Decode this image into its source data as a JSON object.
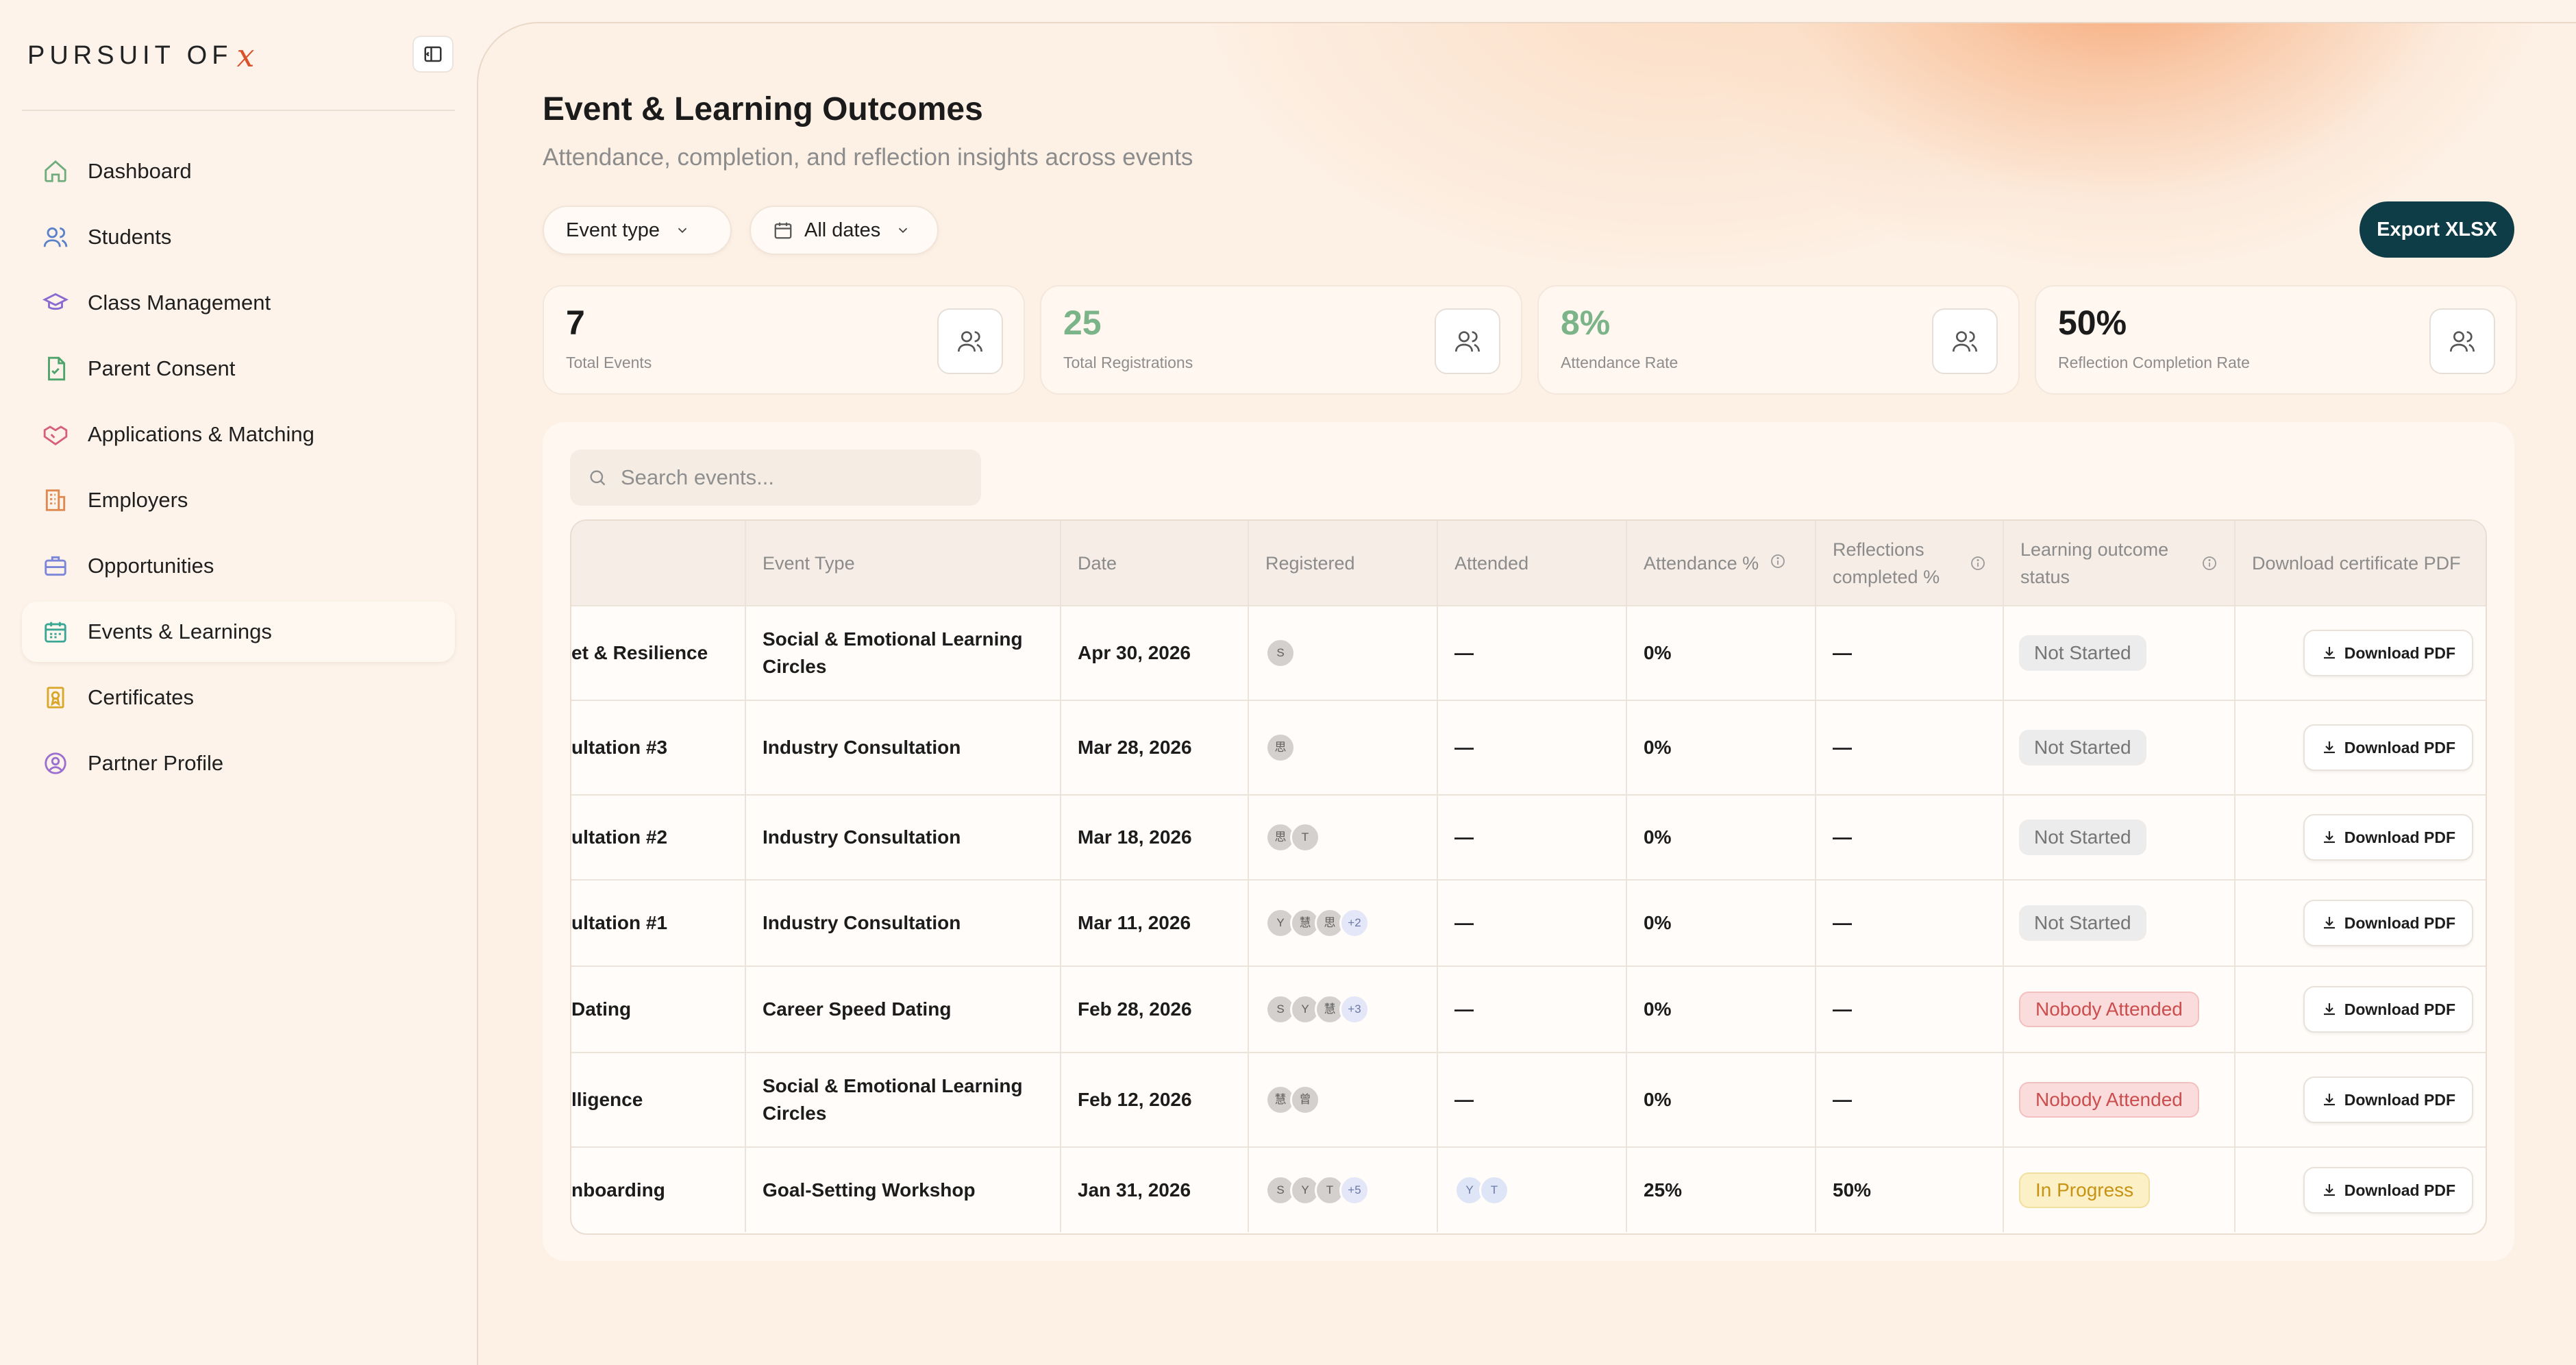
{
  "brand": {
    "text": "PURSUIT OF",
    "mark": "x",
    "accent": "#d9532a"
  },
  "nav": [
    {
      "label": "Dashboard",
      "icon": "home-icon",
      "color": "#6fae7c"
    },
    {
      "label": "Students",
      "icon": "users-icon",
      "color": "#5b82c9"
    },
    {
      "label": "Class Management",
      "icon": "graduation-cap-icon",
      "color": "#8a6ad0"
    },
    {
      "label": "Parent Consent",
      "icon": "document-check-icon",
      "color": "#4ea36a"
    },
    {
      "label": "Applications & Matching",
      "icon": "handshake-icon",
      "color": "#d6607a"
    },
    {
      "label": "Employers",
      "icon": "building-icon",
      "color": "#e0884d"
    },
    {
      "label": "Opportunities",
      "icon": "briefcase-icon",
      "color": "#7a86d8"
    },
    {
      "label": "Events & Learnings",
      "icon": "calendar-icon",
      "color": "#3aa694",
      "active": true
    },
    {
      "label": "Certificates",
      "icon": "award-icon",
      "color": "#d9a62a"
    },
    {
      "label": "Partner Profile",
      "icon": "user-circle-icon",
      "color": "#9a6fd0"
    }
  ],
  "page": {
    "title": "Event & Learning Outcomes",
    "subtitle": "Attendance, completion, and reflection insights across events"
  },
  "filters": {
    "event_type": "Event type",
    "dates": "All dates"
  },
  "export_label": "Export XLSX",
  "stats": [
    {
      "value": "7",
      "label": "Total Events",
      "color": "#1b1b1b"
    },
    {
      "value": "25",
      "label": "Total Registrations",
      "color": "#7cb48a"
    },
    {
      "value": "8%",
      "label": "Attendance Rate",
      "color": "#7cb48a"
    },
    {
      "value": "50%",
      "label": "Reflection Completion Rate",
      "color": "#1b1b1b"
    }
  ],
  "search": {
    "placeholder": "Search events..."
  },
  "table": {
    "headers": {
      "event_type": "Event Type",
      "date": "Date",
      "registered": "Registered",
      "attended": "Attended",
      "attendance_pct": "Attendance %",
      "reflections": "Reflections completed %",
      "status": "Learning outcome status",
      "download": "Download certificate PDF"
    },
    "download_label": "Download PDF",
    "rows": [
      {
        "name": "et & Resilience",
        "type": "Social & Emotional Learning Circles",
        "date": "Apr 30, 2026",
        "registered": [
          "S"
        ],
        "attended": "—",
        "attendance": "0%",
        "reflections": "—",
        "status": "Not Started",
        "status_kind": "grey"
      },
      {
        "name": "ultation #3",
        "type": "Industry Consultation",
        "date": "Mar 28, 2026",
        "registered": [
          "思"
        ],
        "attended": "—",
        "attendance": "0%",
        "reflections": "—",
        "status": "Not Started",
        "status_kind": "grey"
      },
      {
        "name": "ultation #2",
        "type": "Industry Consultation",
        "date": "Mar 18, 2026",
        "registered": [
          "思",
          "T"
        ],
        "attended": "—",
        "attendance": "0%",
        "reflections": "—",
        "status": "Not Started",
        "status_kind": "grey"
      },
      {
        "name": "ultation #1",
        "type": "Industry Consultation",
        "date": "Mar 11, 2026",
        "registered": [
          "Y",
          "慧",
          "思",
          "+2"
        ],
        "attended": "—",
        "attendance": "0%",
        "reflections": "—",
        "status": "Not Started",
        "status_kind": "grey"
      },
      {
        "name": "Dating",
        "type": "Career Speed Dating",
        "date": "Feb 28, 2026",
        "registered": [
          "S",
          "Y",
          "慧",
          "+3"
        ],
        "attended": "—",
        "attendance": "0%",
        "reflections": "—",
        "status": "Nobody Attended",
        "status_kind": "red"
      },
      {
        "name": "lligence",
        "type": "Social & Emotional Learning Circles",
        "date": "Feb 12, 2026",
        "registered": [
          "慧",
          "曾"
        ],
        "attended": "—",
        "attendance": "0%",
        "reflections": "—",
        "status": "Nobody Attended",
        "status_kind": "red"
      },
      {
        "name": "nboarding",
        "type": "Goal-Setting Workshop",
        "date": "Jan 31, 2026",
        "registered": [
          "S",
          "Y",
          "T",
          "+5"
        ],
        "attended_avatars": [
          "Y",
          "T"
        ],
        "attendance": "25%",
        "reflections": "50%",
        "status": "In Progress",
        "status_kind": "yellow"
      }
    ]
  }
}
